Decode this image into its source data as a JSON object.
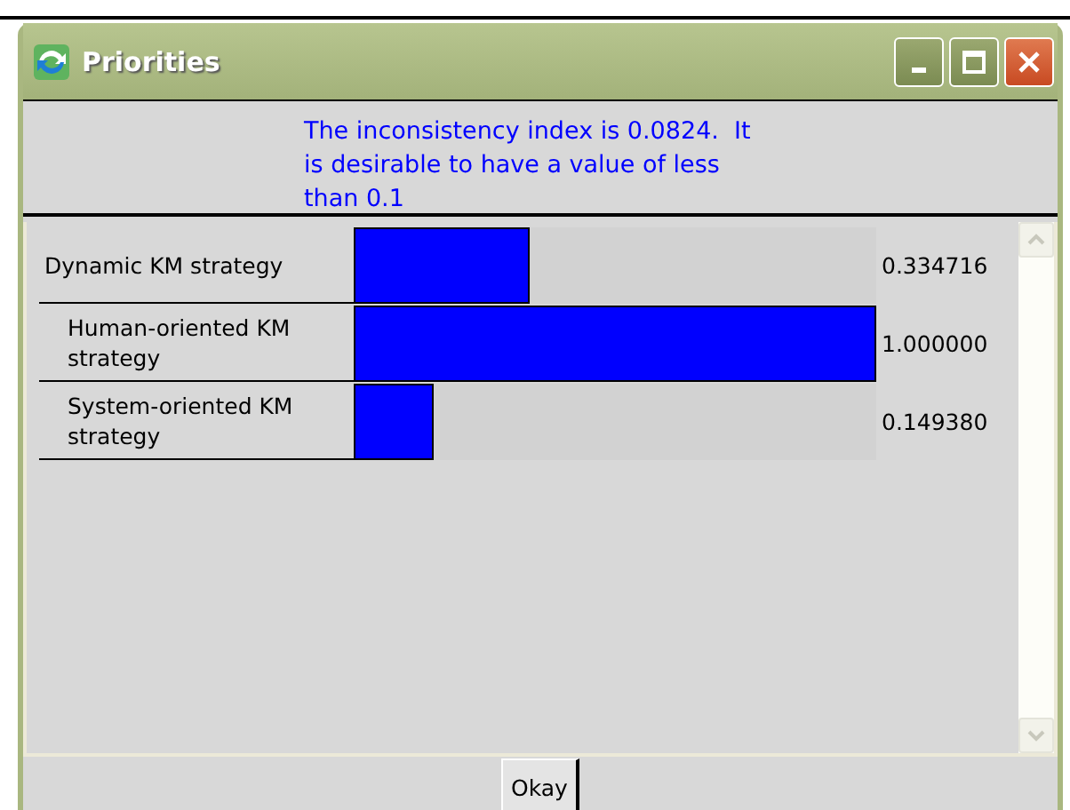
{
  "window": {
    "title": "Priorities"
  },
  "message": "The inconsistency index is 0.0824.  It is desirable to have a value of less than 0.1",
  "priorities": [
    {
      "label": "Dynamic KM strategy",
      "level": 0.334716,
      "value": "0.334716"
    },
    {
      "label": "Human-oriented KM strategy",
      "level": 1.0,
      "value": "1.000000"
    },
    {
      "label": "System-oriented KM strategy",
      "level": 0.14938,
      "value": "0.149380"
    }
  ],
  "buttons": [
    "Okay"
  ]
}
